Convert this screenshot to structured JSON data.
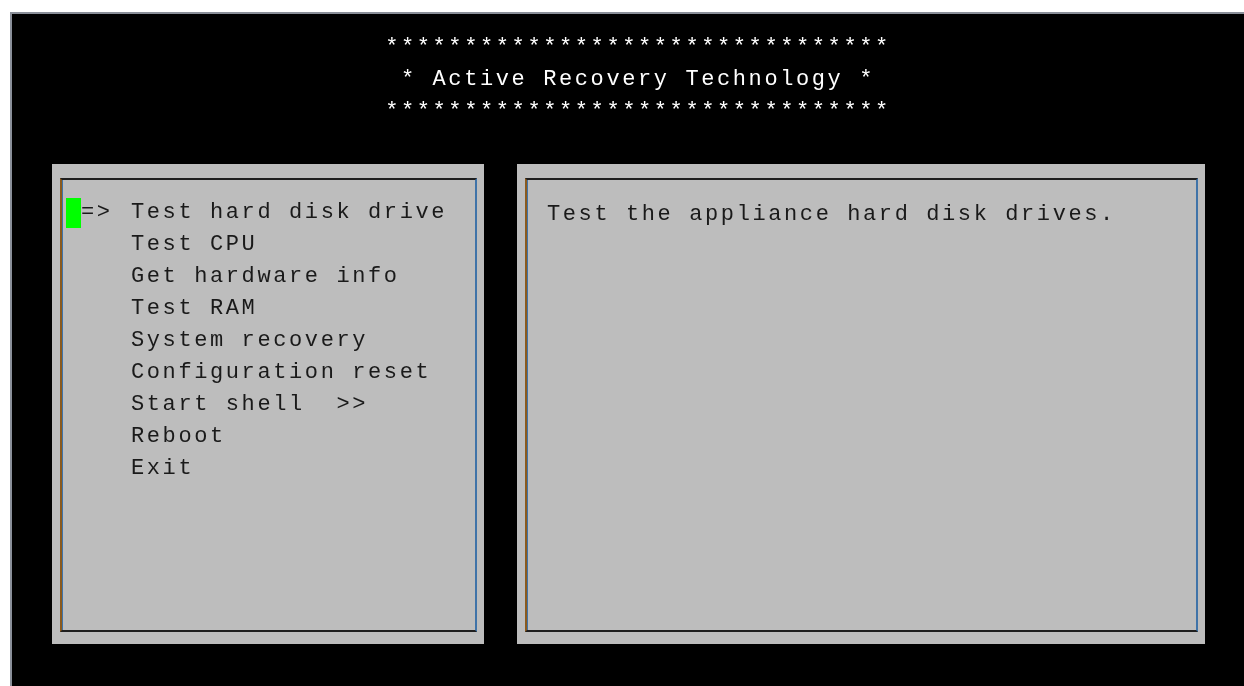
{
  "header": {
    "lines": [
      "********************************",
      "* Active Recovery Technology *",
      "********************************"
    ]
  },
  "menu": {
    "pointer": "=>",
    "items": [
      {
        "label": "Test hard disk drive",
        "selected": true
      },
      {
        "label": "Test CPU",
        "selected": false
      },
      {
        "label": "Get hardware info",
        "selected": false
      },
      {
        "label": "Test RAM",
        "selected": false
      },
      {
        "label": "System recovery",
        "selected": false
      },
      {
        "label": "Configuration reset",
        "selected": false
      },
      {
        "label": "Start shell  >>",
        "selected": false
      },
      {
        "label": "Reboot",
        "selected": false
      },
      {
        "label": "Exit",
        "selected": false
      }
    ]
  },
  "description": {
    "text": "Test the appliance hard disk drives."
  }
}
